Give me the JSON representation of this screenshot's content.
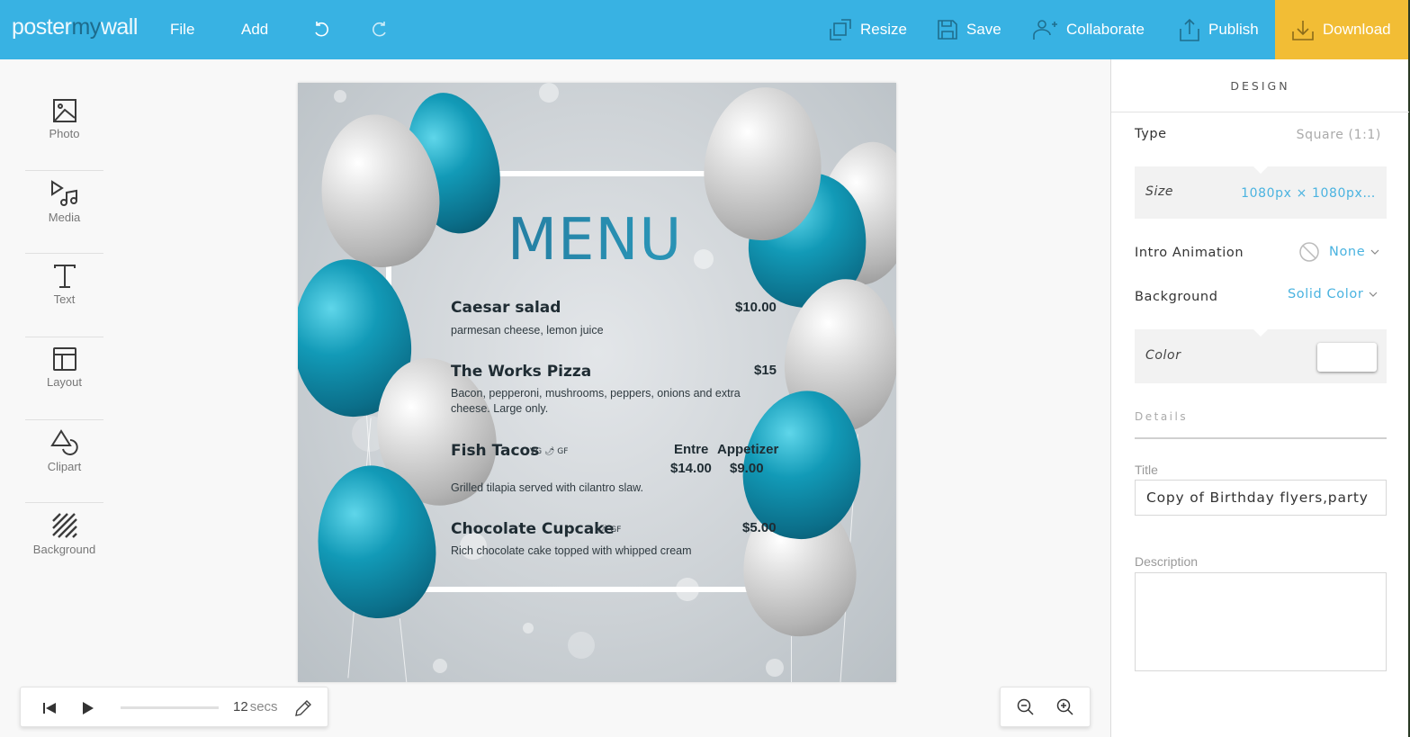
{
  "app": {
    "logo": {
      "part1": "poster",
      "part2": "my",
      "part3": "wall"
    }
  },
  "topbar": {
    "file_label": "File",
    "add_label": "Add",
    "undo_icon": "undo-icon",
    "redo_icon": "redo-icon",
    "resize_label": "Resize",
    "save_label": "Save",
    "collaborate_label": "Collaborate",
    "publish_label": "Publish",
    "download_label": "Download",
    "colors": {
      "bar": "#38b2e3",
      "download": "#f2bd35"
    }
  },
  "sidebar": {
    "items": [
      {
        "label": "Photo",
        "icon": "photo-icon"
      },
      {
        "label": "Media",
        "icon": "media-icon"
      },
      {
        "label": "Text",
        "icon": "text-icon"
      },
      {
        "label": "Layout",
        "icon": "layout-icon"
      },
      {
        "label": "Clipart",
        "icon": "clipart-icon"
      },
      {
        "label": "Background",
        "icon": "background-icon"
      }
    ]
  },
  "poster": {
    "title": "MENU",
    "items": [
      {
        "name": "Caesar salad",
        "price": "$10.00",
        "description": "parmesan cheese, lemon juice",
        "tags": ""
      },
      {
        "name": "The Works Pizza",
        "price": "$15",
        "description": "Bacon, pepperoni, mushrooms, peppers, onions and extra cheese. Large only.",
        "tags": ""
      },
      {
        "name": "Fish Tacos",
        "tags": "VG 🌶 GF",
        "description": "Grilled tilapia served with cilantro slaw.",
        "price_columns": [
          {
            "label": "Entre",
            "price": "$14.00"
          },
          {
            "label": "Appetizer",
            "price": "$9.00"
          }
        ]
      },
      {
        "name": "Chocolate Cupcake",
        "price": "$5.00",
        "description": "Rich chocolate cake topped with whipped cream",
        "tags": "🌶 GF"
      }
    ]
  },
  "panel": {
    "heading": "DESIGN",
    "type_label": "Type",
    "type_value": "Square (1:1)",
    "size_label": "Size",
    "size_value": "1080px × 1080px…",
    "intro_animation_label": "Intro Animation",
    "intro_animation_value": "None",
    "background_label": "Background",
    "background_value": "Solid Color",
    "color_label": "Color",
    "color_value": "#ffffff",
    "details_heading": "Details",
    "title_label": "Title",
    "title_value": "Copy of Birthday flyers,party",
    "description_label": "Description",
    "description_value": ""
  },
  "player": {
    "duration_value": "12",
    "duration_unit": "secs",
    "progress": 0
  }
}
